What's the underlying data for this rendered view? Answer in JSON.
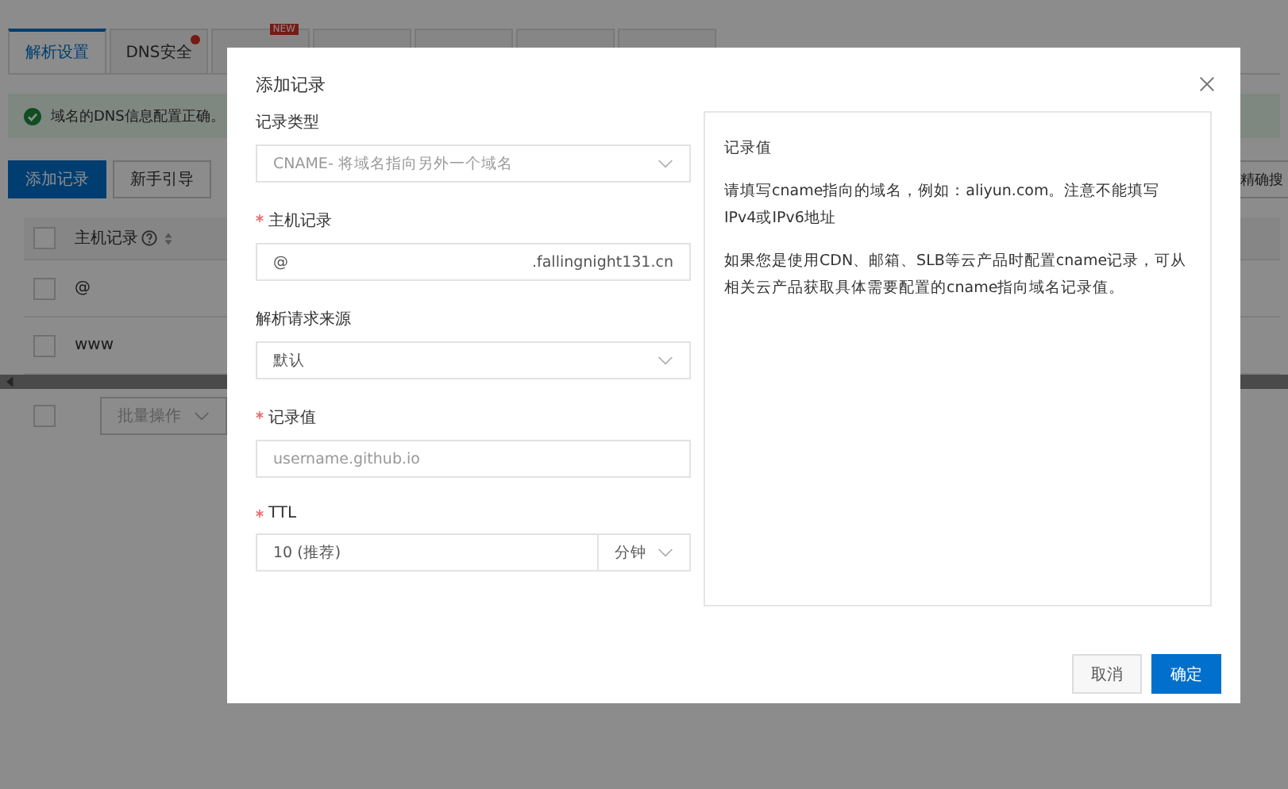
{
  "tabs": [
    {
      "label": "解析设置",
      "selected": true,
      "dot": false
    },
    {
      "label": "DNS安全",
      "selected": false,
      "dot": true
    },
    {
      "badge": "NEW",
      "selected": false,
      "dot": false
    },
    {
      "selected": false,
      "dot": false
    },
    {
      "selected": false,
      "dot": false
    },
    {
      "selected": false,
      "dot": false
    },
    {
      "selected": false,
      "dot": false
    }
  ],
  "alert": {
    "text": "域名的DNS信息配置正确。"
  },
  "toolbar": {
    "buttons": [
      {
        "label": "添加记录",
        "primary": true
      },
      {
        "label": "新手引导",
        "primary": false
      }
    ],
    "search_label": "精确搜"
  },
  "table": {
    "header_checked": false,
    "footer_checked": false,
    "columns": [
      {
        "label": "主机记录"
      }
    ],
    "rows": [
      {
        "host": "@",
        "checked": false
      },
      {
        "host": "www",
        "checked": false
      }
    ],
    "batch": "批量操作"
  },
  "dialog": {
    "title": "添加记录",
    "fields": [
      {
        "kind": "select",
        "label": "记录类型",
        "required": false,
        "disabled": true,
        "value": "CNAME- 将域名指向另外一个域名"
      },
      {
        "kind": "suffix",
        "label": "主机记录",
        "required": true,
        "value": "@",
        "suffix": ".fallingnight131.cn"
      },
      {
        "kind": "select",
        "label": "解析请求来源",
        "required": false,
        "disabled": false,
        "value": "默认"
      },
      {
        "kind": "input",
        "label": "记录值",
        "required": true,
        "placeholder": "username.github.io"
      },
      {
        "kind": "unit",
        "label": "TTL",
        "required": true,
        "value": "10 (推荐)",
        "unit": "分钟"
      }
    ],
    "help": {
      "title": "记录值",
      "paragraphs": [
        "请填写cname指向的域名，例如：aliyun.com。注意不能填写IPv4或IPv6地址",
        "如果您是使用CDN、邮箱、SLB等云产品时配置cname记录，可从相关云产品获取具体需要配置的cname指向域名记录值。"
      ]
    },
    "buttons": [
      {
        "label": "取消",
        "primary": false
      },
      {
        "label": "确定",
        "primary": true
      }
    ]
  }
}
